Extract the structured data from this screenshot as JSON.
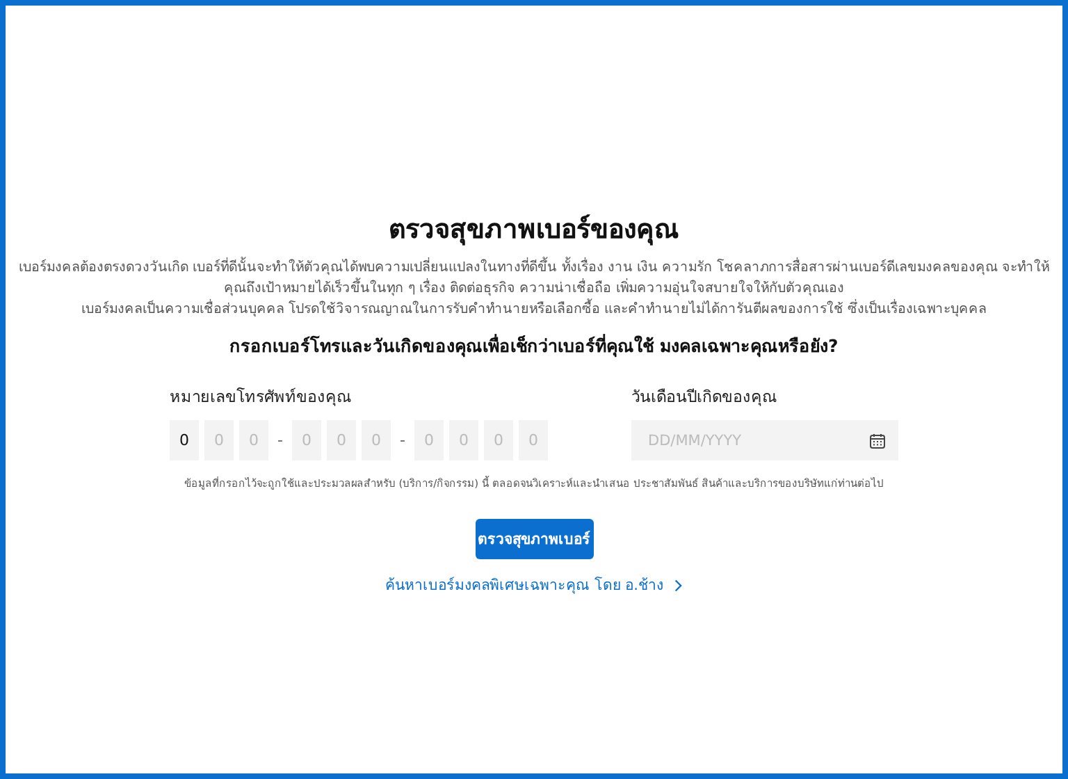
{
  "title": "ตรวจสุขภาพเบอร์ของคุณ",
  "paragraphs": [
    "เบอร์มงคลต้องตรงดวงวันเกิด เบอร์ที่ดีนั้นจะทำให้ตัวคุณได้พบความเปลี่ยนแปลงในทางที่ดีขึ้น ทั้งเรื่อง งาน เงิน ความรัก โชคลาภการสื่อสารผ่านเบอร์ดีเลขมงคลของคุณ จะทำให้คุณถึงเป้าหมายได้เร็วขึ้นในทุก ๆ เรื่อง ติดต่อธุรกิจ ความน่าเชื่อถือ เพิ่มความอุ่นใจสบายใจให้กับตัวคุณเอง",
    "เบอร์มงคลเป็นความเชื่อส่วนบุคคล โปรดใช้วิจารณญาณในการรับคำทำนายหรือเลือกซื้อ และคำทำนายไม่ได้การันตีผลของการใช้ ซึ่งเป็นเรื่องเฉพาะบุคคล"
  ],
  "question": "กรอกเบอร์โทรและวันเกิดของคุณเพื่อเช็กว่าเบอร์ที่คุณใช้ มงคลเฉพาะคุณหรือยัง?",
  "phone": {
    "label": "หมายเลขโทรศัพท์ของคุณ",
    "slots": [
      {
        "kind": "digit",
        "value": "0"
      },
      {
        "kind": "digit",
        "placeholder": "0"
      },
      {
        "kind": "digit",
        "placeholder": "0"
      },
      {
        "kind": "dash",
        "text": "-"
      },
      {
        "kind": "digit",
        "placeholder": "0"
      },
      {
        "kind": "digit",
        "placeholder": "0"
      },
      {
        "kind": "digit",
        "placeholder": "0"
      },
      {
        "kind": "dash",
        "text": "-"
      },
      {
        "kind": "digit",
        "placeholder": "0"
      },
      {
        "kind": "digit",
        "placeholder": "0"
      },
      {
        "kind": "digit",
        "placeholder": "0"
      },
      {
        "kind": "digit",
        "placeholder": "0"
      }
    ]
  },
  "birthday": {
    "label": "วันเดือนปีเกิดของคุณ",
    "placeholder": "DD/MM/YYYY"
  },
  "consent": "ข้อมูลที่กรอกไว้จะถูกใช้และประมวลผลสำหรับ (บริการ/กิจกรรม) นี้ ตลอดจนวิเคราะห์และนำเสนอ ประชาสัมพันธ์ สินค้าและบริการของบริษัทแก่ท่านต่อไป",
  "button": "ตรวจสุขภาพเบอร์",
  "link": "ค้นหาเบอร์มงคลพิเศษเฉพาะคุณ โดย อ.ช้าง"
}
